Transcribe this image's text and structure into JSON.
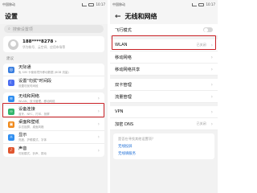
{
  "left": {
    "status_time": "中国移动",
    "status_right": "10:17",
    "title": "设置",
    "search_placeholder": "搜索设置项",
    "account": {
      "name": "188****8278 ›",
      "sub": "华为帐号、云空间、应用市场等"
    },
    "section_label": "建议",
    "suggestions": [
      {
        "label": "天际通",
        "sub": "免 SIM 卡使用境外移动数据 (6GB 流量)",
        "color": "#3b7fe0",
        "icon": "globe-icon"
      },
      {
        "label": "设置\"勿扰\"时间段",
        "sub": "设置勿扰时间段",
        "color": "#4a6cf0",
        "icon": "moon-icon"
      }
    ],
    "items": [
      {
        "label": "无线和网络",
        "sub": "WLAN、双卡管理、移动网络",
        "color": "#2f8ef0",
        "icon": "wifi-icon"
      },
      {
        "label": "设备连接",
        "sub": "蓝牙、NFC、打印、投屏",
        "color": "#33b66c",
        "icon": "link-icon"
      },
      {
        "label": "桌面和壁纸",
        "sub": "杂志锁屏、桌面风格",
        "color": "#f08a1c",
        "icon": "image-icon"
      },
      {
        "label": "显示",
        "sub": "亮度、护眼模式、字体",
        "color": "#2f8ef0",
        "icon": "display-icon"
      },
      {
        "label": "声音",
        "sub": "勿扰模式、铃声、振动",
        "color": "#e0562f",
        "icon": "sound-icon"
      }
    ]
  },
  "right": {
    "status_time": "中国移动",
    "status_right": "10:17",
    "title": "无线和网络",
    "back_glyph": "←",
    "airplane": "飞行模式",
    "wlan": {
      "label": "WLAN",
      "value": "已关闭"
    },
    "mobile_network": "移动网络",
    "hotspot": "移动网络共享",
    "dual_sim": "双卡管理",
    "traffic": "流量管理",
    "vpn": "VPN",
    "private_dns": {
      "label": "加密 DNS",
      "value": "已关闭"
    },
    "hint_title": "是否在寻找其他设置项？",
    "hint_link1": "无线投屏",
    "hint_link2": "无线填服务"
  },
  "colors": {
    "highlight": "#c81f24",
    "link": "#1f6fd6"
  }
}
